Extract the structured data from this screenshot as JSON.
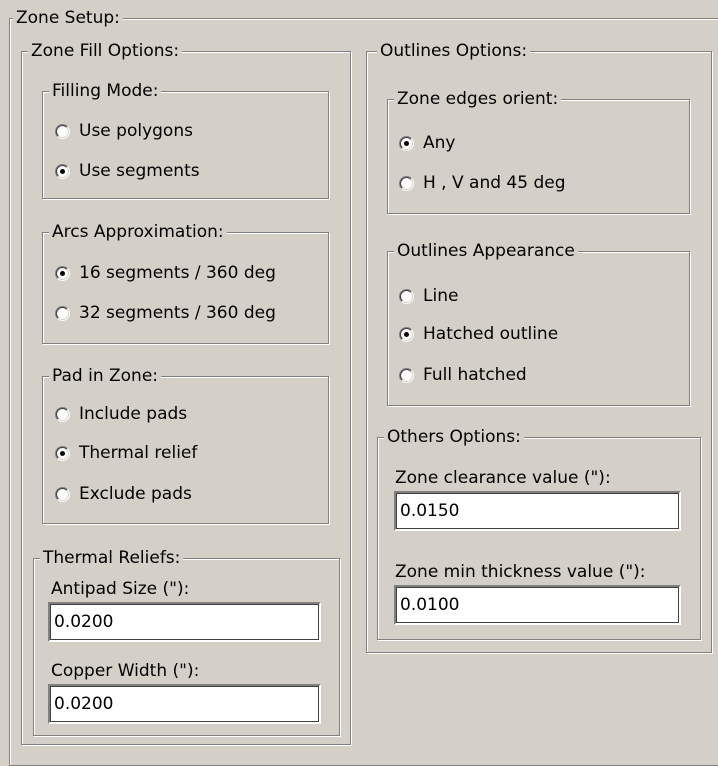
{
  "zone_setup": {
    "title": "Zone Setup:",
    "fill_options": {
      "title": "Zone Fill Options:",
      "filling_mode": {
        "title": "Filling Mode:",
        "options": [
          "Use polygons",
          "Use segments"
        ],
        "selected": 1
      },
      "arcs": {
        "title": "Arcs Approximation:",
        "options": [
          "16 segments / 360 deg",
          "32 segments / 360 deg"
        ],
        "selected": 0
      },
      "pad_in_zone": {
        "title": "Pad in Zone:",
        "options": [
          "Include pads",
          "Thermal relief",
          "Exclude pads"
        ],
        "selected": 1
      },
      "thermal_reliefs": {
        "title": "Thermal Reliefs:",
        "antipad_label": "Antipad Size (\"):",
        "antipad_value": "0.0200",
        "copper_label": "Copper Width (\"):",
        "copper_value": "0.0200"
      }
    },
    "outlines_options": {
      "title": "Outlines Options:",
      "edges_orient": {
        "title": "Zone edges orient:",
        "options": [
          "Any",
          "H , V and 45 deg"
        ],
        "selected": 0
      },
      "appearance": {
        "title": "Outlines Appearance",
        "options": [
          "Line",
          "Hatched outline",
          "Full hatched"
        ],
        "selected": 1
      }
    },
    "others_options": {
      "title": "Others Options:",
      "clearance_label": "Zone clearance value (\"):",
      "clearance_value": "0.0150",
      "min_thickness_label": "Zone min thickness value (\"):",
      "min_thickness_value": "0.0100"
    }
  }
}
